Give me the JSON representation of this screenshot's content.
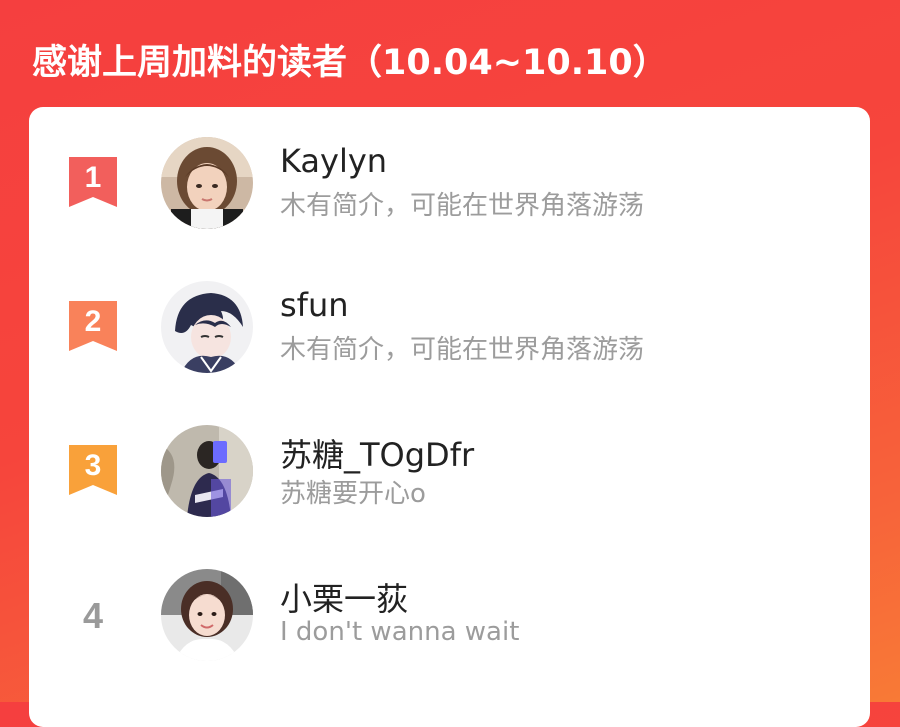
{
  "header": {
    "title": "感谢上周加料的读者（10.04~10.10）"
  },
  "readers": [
    {
      "rank": "1",
      "name": "Kaylyn",
      "bio": "木有简介，可能在世界角落游荡",
      "badge_color": "#f25f5c",
      "avatar_icon": "girl-portrait-avatar"
    },
    {
      "rank": "2",
      "name": "sfun",
      "bio": "木有简介，可能在世界角落游荡",
      "badge_color": "#f9825a",
      "avatar_icon": "anime-boy-avatar"
    },
    {
      "rank": "3",
      "name": "苏糖_TOgDfr",
      "bio": "苏糖要开心o",
      "badge_color": "#f9a13a",
      "avatar_icon": "mirror-selfie-avatar"
    },
    {
      "rank": "4",
      "name": "小栗一荻",
      "bio": "I don't wanna wait",
      "badge_color": "",
      "avatar_icon": "girl-smiling-avatar"
    }
  ]
}
